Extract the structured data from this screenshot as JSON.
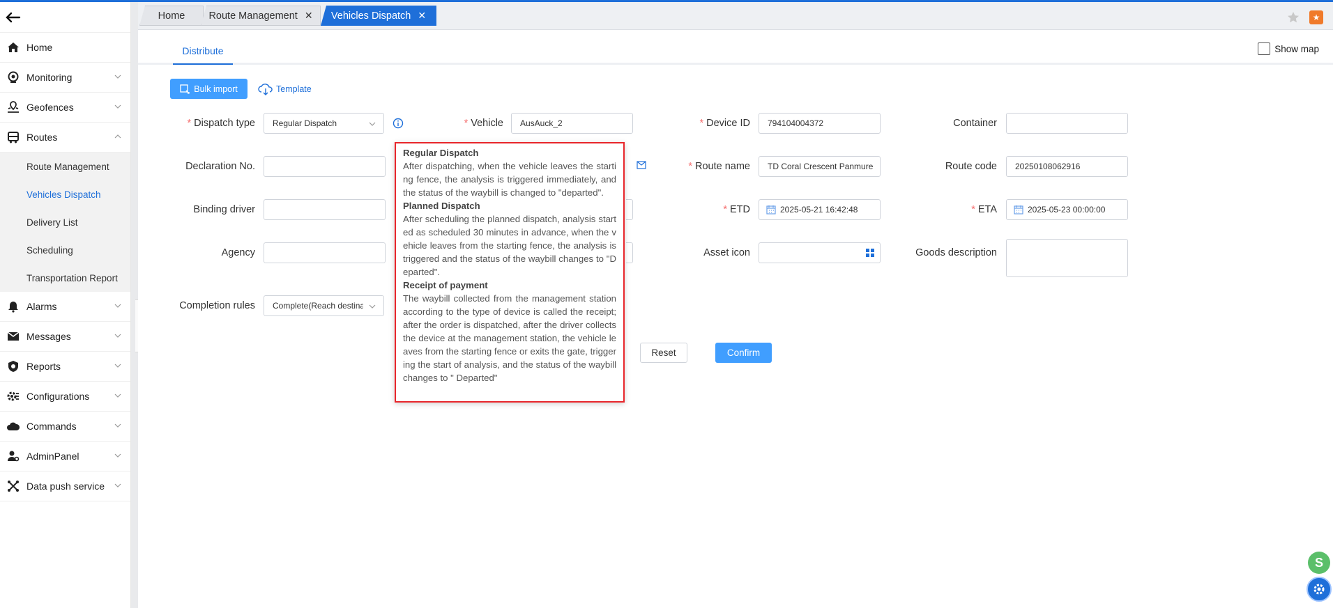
{
  "tabs": [
    {
      "label": "Home"
    },
    {
      "label": "Route Management"
    },
    {
      "label": "Vehicles Dispatch"
    }
  ],
  "sidebar": {
    "items": [
      {
        "label": "Home",
        "icon": "home-icon"
      },
      {
        "label": "Monitoring",
        "icon": "monitoring-icon"
      },
      {
        "label": "Geofences",
        "icon": "geofence-icon"
      },
      {
        "label": "Routes",
        "icon": "routes-icon"
      },
      {
        "label": "Alarms",
        "icon": "alarm-icon"
      },
      {
        "label": "Messages",
        "icon": "mail-icon"
      },
      {
        "label": "Reports",
        "icon": "report-icon"
      },
      {
        "label": "Configurations",
        "icon": "settings-icon"
      },
      {
        "label": "Commands",
        "icon": "command-icon"
      },
      {
        "label": "AdminPanel",
        "icon": "admin-icon"
      },
      {
        "label": "Data push service",
        "icon": "data-push-icon"
      }
    ],
    "routes_sub": [
      {
        "label": "Route Management"
      },
      {
        "label": "Vehicles Dispatch"
      },
      {
        "label": "Delivery List"
      },
      {
        "label": "Scheduling"
      },
      {
        "label": "Transportation Report"
      }
    ]
  },
  "main": {
    "subtab": "Distribute",
    "show_map": "Show map",
    "bulk_import": "Bulk import",
    "template": "Template",
    "reset": "Reset",
    "confirm": "Confirm"
  },
  "form": {
    "dispatch_type_label": "Dispatch type",
    "dispatch_type_value": "Regular Dispatch",
    "vehicle_label": "Vehicle",
    "vehicle_value": "AusAuck_2",
    "device_id_label": "Device ID",
    "device_id_value": "794104004372",
    "container_label": "Container",
    "declaration_label": "Declaration No.",
    "route_name_label": "Route name",
    "route_name_value": "TD Coral Crescent Panmure",
    "route_code_label": "Route code",
    "route_code_value": "20250108062916",
    "binding_driver_label": "Binding driver",
    "etd_label": "ETD",
    "etd_value": "2025-05-21 16:42:48",
    "eta_label": "ETA",
    "eta_value": "2025-05-23 00:00:00",
    "agency_label": "Agency",
    "asset_icon_label": "Asset icon",
    "goods_label": "Goods description",
    "completion_label": "Completion rules",
    "completion_value": "Complete(Reach destination)"
  },
  "tooltip": {
    "h1": "Regular Dispatch",
    "p1": "After dispatching, when the vehicle leaves the starting fence, the analysis is triggered immediately, and the status of the waybill is changed to \"departed\".",
    "h2": "Planned Dispatch",
    "p2": "After scheduling the planned dispatch, analysis started as scheduled 30 minutes in advance, when the vehicle leaves from the starting fence, the analysis is triggered and the status of the waybill changes to \"Departed\".",
    "h3": "Receipt of payment",
    "p3": "The waybill collected from the management station according to the type of device is called the receipt; after the order is dispatched, after the driver collects the device at the management station, the vehicle leaves from the starting fence or exits the gate, triggering the start of analysis, and the status of the waybill changes to \" Departed\""
  },
  "colors": {
    "accent": "#1e6fd9",
    "button": "#409eff",
    "required": "#f56c6c",
    "highlight": "#e8262b"
  }
}
